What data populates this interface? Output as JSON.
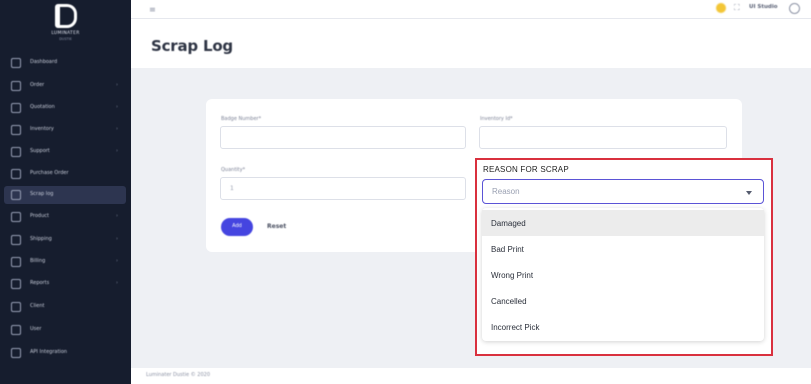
{
  "sidebar": {
    "brand_name": "LUMINATER",
    "brand_sub": "DUSTIE",
    "items": [
      {
        "label": "Dashboard",
        "chevron": "",
        "icon": "grid-icon"
      },
      {
        "label": "Order",
        "chevron": "›",
        "icon": "order-icon"
      },
      {
        "label": "Quotation",
        "chevron": "›",
        "icon": "quotation-icon"
      },
      {
        "label": "Inventory",
        "chevron": "›",
        "icon": "inventory-icon"
      },
      {
        "label": "Support",
        "chevron": "›",
        "icon": "support-icon"
      },
      {
        "label": "Purchase Order",
        "chevron": "",
        "icon": "purchase-icon"
      },
      {
        "label": "Scrap log",
        "chevron": "",
        "icon": "scrap-icon"
      },
      {
        "label": "Product",
        "chevron": "›",
        "icon": "product-icon"
      },
      {
        "label": "Shipping",
        "chevron": "›",
        "icon": "shipping-icon"
      },
      {
        "label": "Billing",
        "chevron": "›",
        "icon": "billing-icon"
      },
      {
        "label": "Reports",
        "chevron": "›",
        "icon": "reports-icon"
      },
      {
        "label": "Client",
        "chevron": "",
        "icon": "client-icon"
      },
      {
        "label": "User",
        "chevron": "",
        "icon": "user-icon"
      },
      {
        "label": "API Integration",
        "chevron": "",
        "icon": "api-icon"
      }
    ],
    "active_label": "Scrap log"
  },
  "topbar": {
    "menu_glyph": "≡",
    "expand_glyph": "⛶",
    "user_name": "UI Studio"
  },
  "page": {
    "title": "Scrap Log"
  },
  "form": {
    "badge_label": "Badge Number*",
    "inventory_label": "Inventory Id*",
    "quantity_label": "Quantity*",
    "quantity_value": "1",
    "add_label": "Add",
    "reset_label": "Reset"
  },
  "reason": {
    "label": "REASON FOR SCRAP",
    "placeholder": "Reason",
    "options": [
      "Damaged",
      "Bad Print",
      "Wrong Print",
      "Cancelled",
      "Incorrect Pick"
    ],
    "hovered": "Damaged"
  },
  "footer": {
    "text": "Luminater Dustie © 2020"
  },
  "colors": {
    "sidebar_bg": "#161d2e",
    "accent": "#4545e0",
    "highlight_border": "#d9303e",
    "select_border": "#5b54d6"
  }
}
